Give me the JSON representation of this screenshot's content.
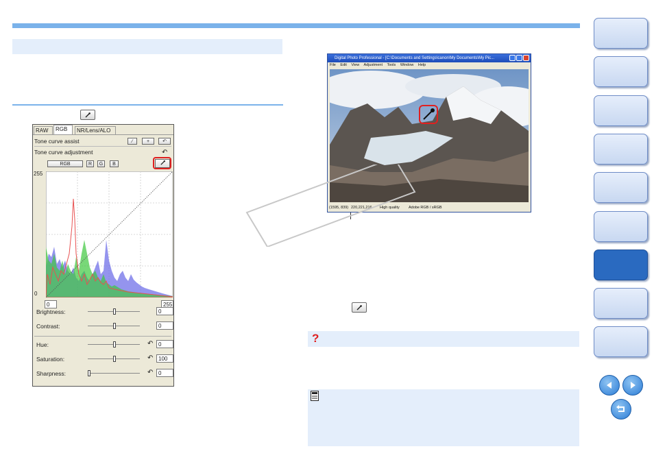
{
  "panel": {
    "tabs": [
      "RAW",
      "RGB",
      "NR/Lens/ALO"
    ],
    "active_tab": "RGB",
    "tone_curve_assist": "Tone curve assist",
    "tone_curve_adjustment": "Tone curve adjustment",
    "channel_buttons": [
      "RGB",
      "R",
      "G",
      "B"
    ],
    "curve_top_value": "255",
    "curve_bottom_value": "0",
    "input_left": "0",
    "input_right": "255",
    "sliders": [
      {
        "label": "Brightness:",
        "value": "0",
        "position": 0.5,
        "has_reset": false
      },
      {
        "label": "Contrast:",
        "value": "0",
        "position": 0.5,
        "has_reset": false
      },
      {
        "label": "Hue:",
        "value": "0",
        "position": 0.5,
        "has_reset": true
      },
      {
        "label": "Saturation:",
        "value": "100",
        "position": 0.5,
        "has_reset": true
      },
      {
        "label": "Sharpness:",
        "value": "0",
        "position": 0.0,
        "has_reset": true
      }
    ],
    "histogram_colors": {
      "red": "#e85050",
      "green": "#3ec83e",
      "blue": "#5a5ae0"
    }
  },
  "window": {
    "title": "Digital Photo Professional - [C:\\Documents and Settings\\canon\\My Documents\\My Pic...",
    "menu": [
      "File",
      "Edit",
      "View",
      "Adjustment",
      "Tools",
      "Window",
      "Help"
    ],
    "status": {
      "coords": "(1595, 839)",
      "rgb": "220,221,216",
      "quality": "High quality",
      "colorspace": "Adobe RGB / sRGB"
    }
  },
  "colors": {
    "accent_blue": "#7ab2ea",
    "light_box": "#e4eefb",
    "highlight_red": "#e02020",
    "nav_active": "#2a6ac0"
  },
  "icons": {
    "eyedropper": "eyedropper-icon",
    "question": "question-icon",
    "note": "memo-icon",
    "prev": "arrow-left-icon",
    "next": "arrow-right-icon",
    "back": "return-icon"
  },
  "nav": {
    "count": 9,
    "active_index": 6
  }
}
